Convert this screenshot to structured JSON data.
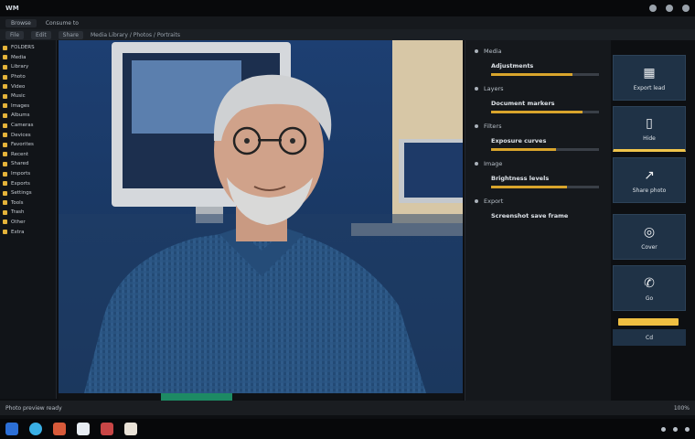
{
  "window": {
    "title": "WM"
  },
  "menubar": {
    "tab": "Browse",
    "path": "Consume to"
  },
  "toolbar": {
    "buttons": [
      "File",
      "Edit",
      "Share"
    ],
    "path": "Media Library / Photos / Portraits"
  },
  "sidebar": {
    "items": [
      "FOLDERS",
      "Media",
      "Library",
      "Photo",
      "Video",
      "Music",
      "Images",
      "Albums",
      "Cameras",
      "Devices",
      "Favorites",
      "Recent",
      "Shared",
      "Imports",
      "Exports",
      "Settings",
      "Tools",
      "Trash",
      "Other",
      "Extra"
    ]
  },
  "panel": {
    "sections": [
      {
        "head": "Media",
        "label": "Adjustments",
        "value": 0.75
      },
      {
        "head": "Layers",
        "label": "Document markers",
        "value": 0.85
      },
      {
        "head": "Filters",
        "label": "Exposure curves",
        "value": 0.6
      },
      {
        "head": "Image",
        "label": "Brightness levels",
        "value": 0.7
      },
      {
        "head": "Export",
        "label": "Screenshot save frame",
        "value": 0
      }
    ]
  },
  "tiles": [
    {
      "label": "Export lead",
      "icon": "qr-icon"
    },
    {
      "label": "Hide",
      "icon": "file-icon"
    },
    {
      "label": "Share photo",
      "icon": "share-icon"
    },
    {
      "label": "Cover",
      "icon": "camera-icon"
    },
    {
      "label": "Go",
      "icon": "phone-icon"
    }
  ],
  "caption": "Cd",
  "statusbar": {
    "text": "Photo preview ready",
    "zoom": "100%"
  }
}
